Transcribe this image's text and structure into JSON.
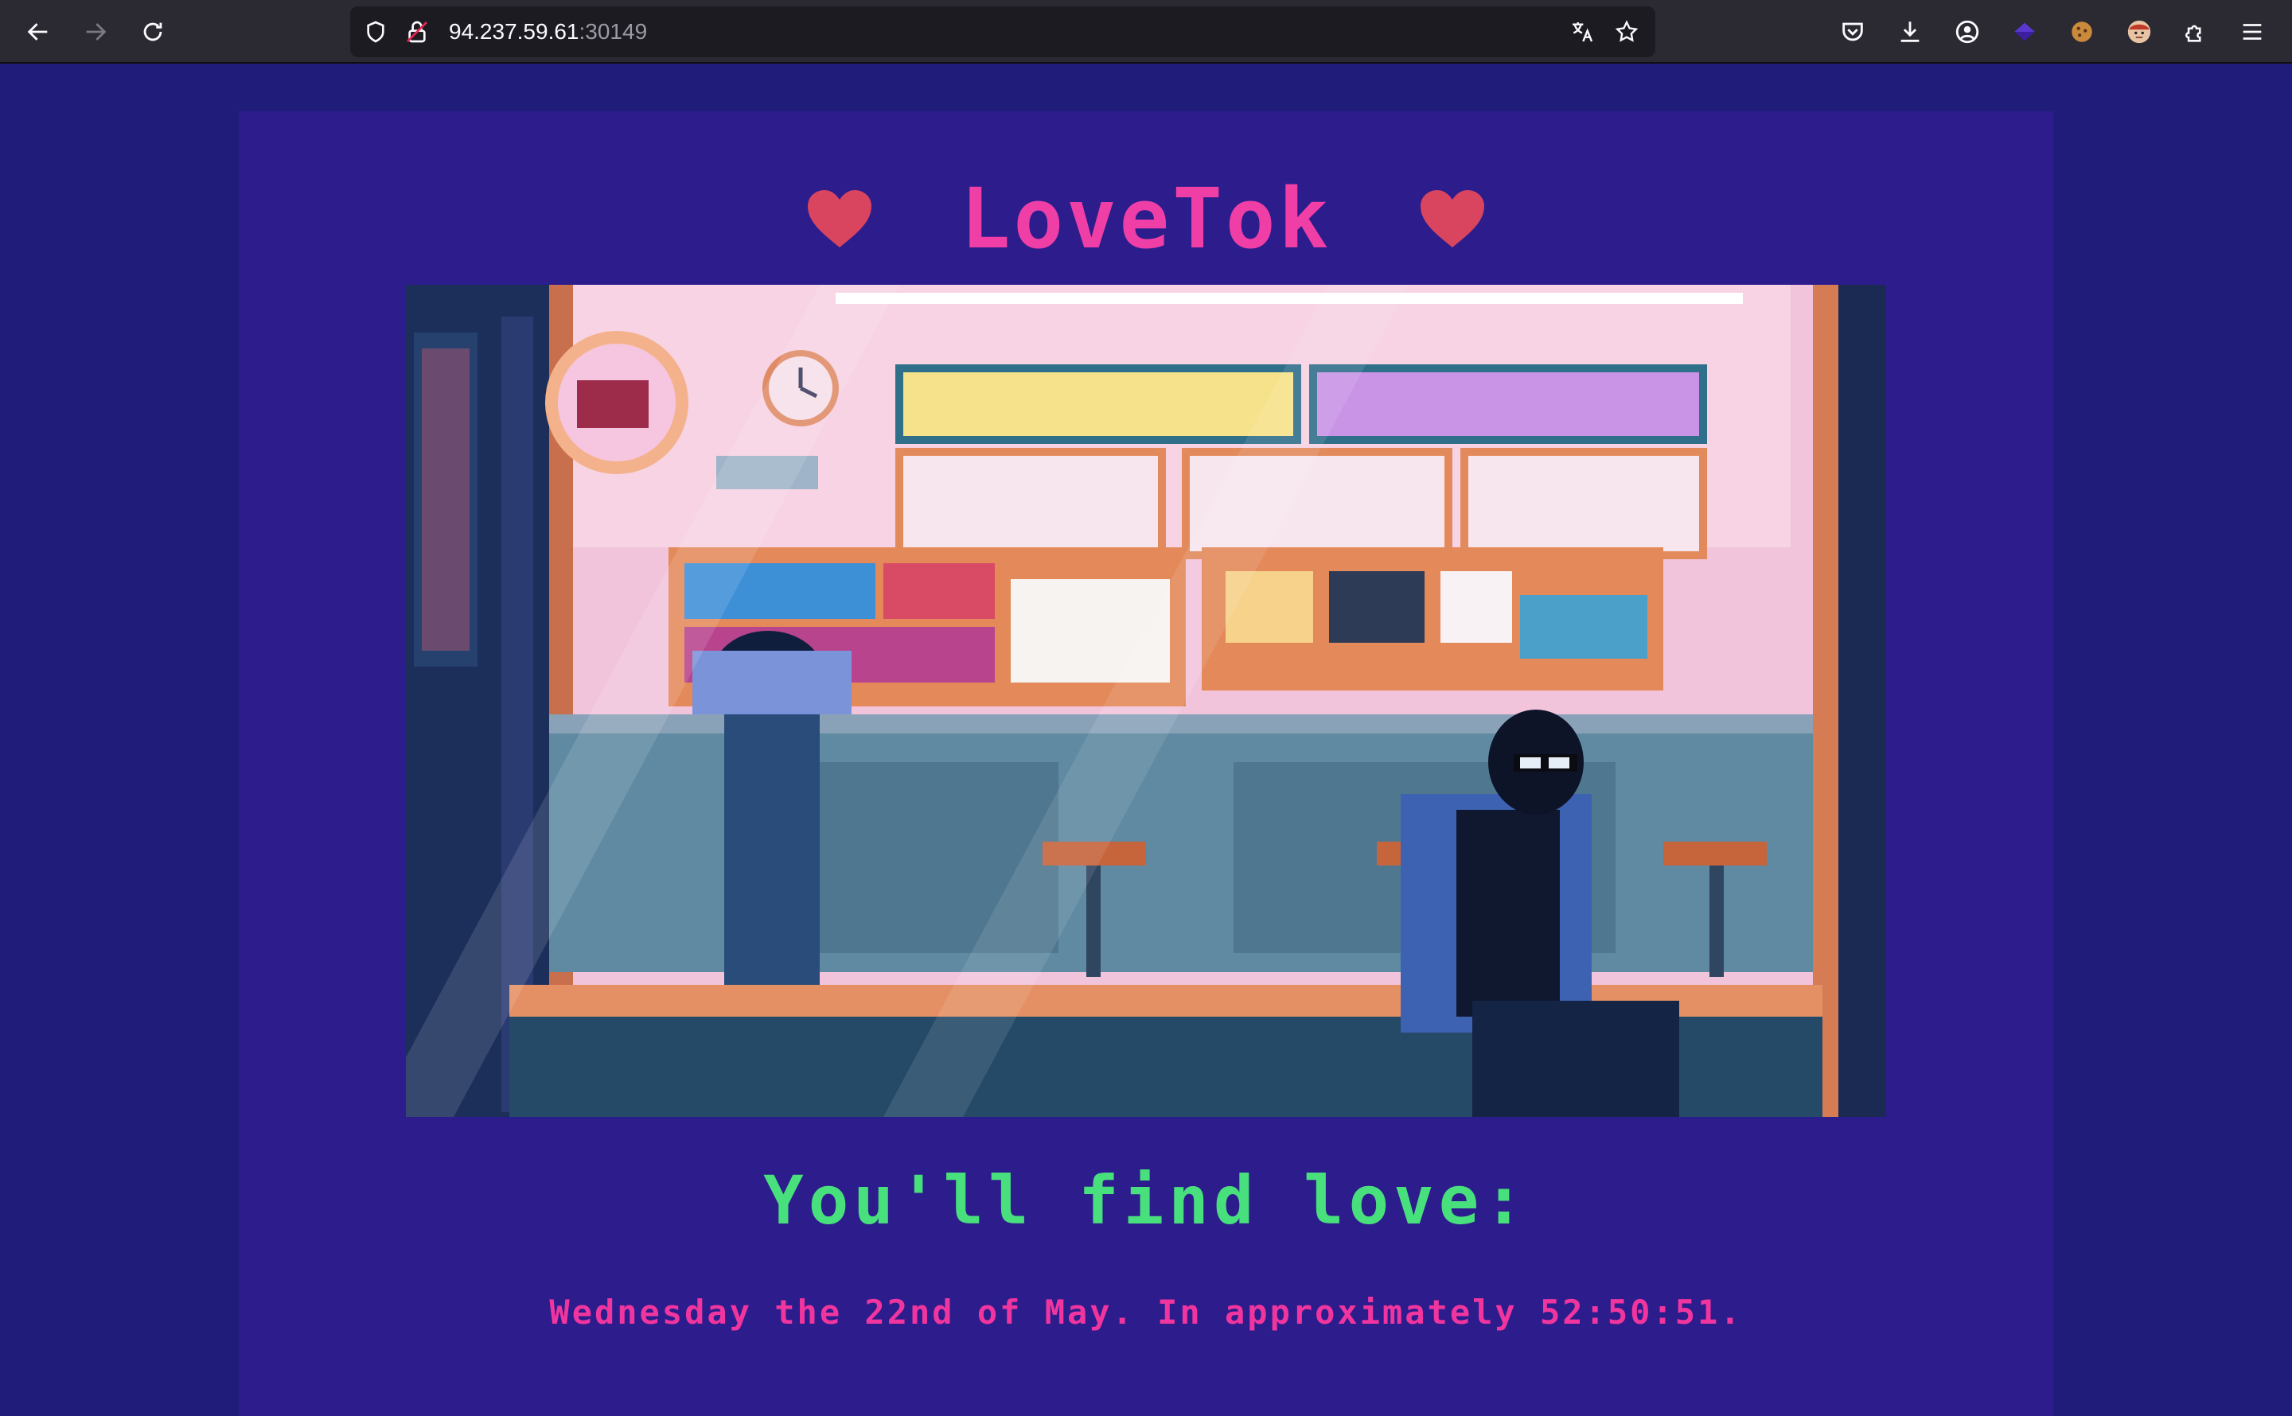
{
  "browser": {
    "url_host": "94.237.59.61",
    "url_port": ":30149",
    "icons": {
      "back": "back-arrow-icon",
      "forward": "forward-arrow-icon",
      "reload": "reload-icon",
      "site_info": "shield-icon",
      "connection": "insecure-lock-icon",
      "translate": "translate-icon",
      "bookmark": "star-icon",
      "pocket": "pocket-icon",
      "downloads": "download-icon",
      "account": "account-icon",
      "extension_1": "diamond-extension-icon",
      "extension_2": "cookie-extension-icon",
      "extension_3": "avatar-extension-icon",
      "extensions": "puzzle-icon",
      "menu": "hamburger-menu-icon"
    }
  },
  "app": {
    "title": "LoveTok",
    "hero_image_name": "pixel-art-convenience-store",
    "subheading": "You'll find love:",
    "result_text": "Wednesday the 22nd of May. In approximately 52:50:51."
  },
  "colors": {
    "page_bg": "#201c7a",
    "card_bg": "#2d1c8c",
    "title": "#ef3fa6",
    "heart": "#d9455f",
    "subheading": "#48e07c",
    "result": "#f0359f"
  }
}
